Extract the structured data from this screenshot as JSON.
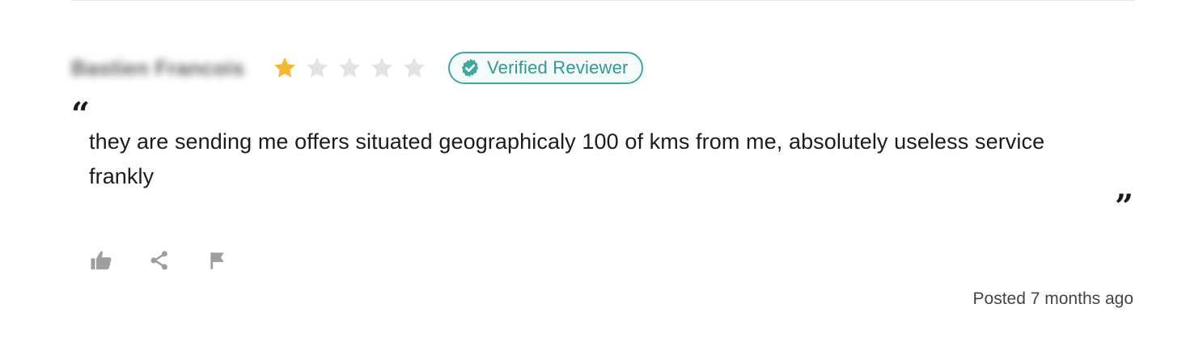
{
  "reviewer": {
    "name": "Bastien Francois"
  },
  "rating": {
    "value": 1,
    "max": 5,
    "filled_color": "#F4B92F",
    "empty_color": "#E3E3E3"
  },
  "badge": {
    "label": "Verified Reviewer",
    "icon": "verified-check-icon",
    "color": "#3EA99F"
  },
  "review": {
    "open_quote": "“",
    "close_quote": "”",
    "text": "they are sending me offers situated geographicaly 100 of kms from me, absolutely useless service frankly"
  },
  "actions": [
    {
      "icon": "thumbs-up-icon"
    },
    {
      "icon": "share-icon"
    },
    {
      "icon": "flag-icon"
    }
  ],
  "colors": {
    "icon_gray": "#9E9E9E"
  },
  "posted": {
    "label": "Posted 7 months ago"
  }
}
